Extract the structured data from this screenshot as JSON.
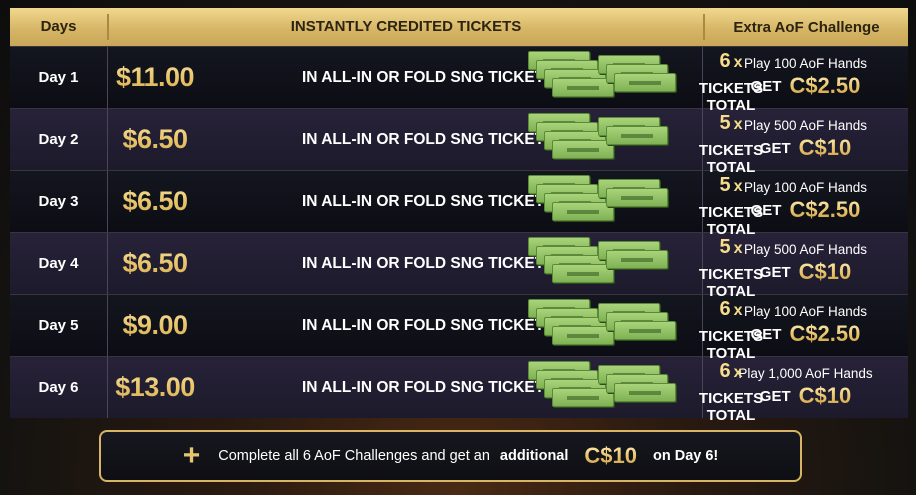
{
  "header": {
    "days": "Days",
    "tickets": "INSTANTLY CREDITED TICKETS",
    "challenge": "Extra AoF Challenge"
  },
  "rows": [
    {
      "day": "Day 1",
      "price": "$11.00",
      "label": "IN ALL-IN OR FOLD SNG TICKETS",
      "count": "6",
      "x": "x",
      "total": "TICKETS TOTAL",
      "play": "Play 100 AoF Hands",
      "get": "GET",
      "amount": "C$2.50"
    },
    {
      "day": "Day 2",
      "price": "$6.50",
      "label": "IN ALL-IN OR FOLD SNG TICKETS",
      "count": "5",
      "x": "x",
      "total": "TICKETS TOTAL",
      "play": "Play 500 AoF Hands",
      "get": "GET",
      "amount": "C$10"
    },
    {
      "day": "Day 3",
      "price": "$6.50",
      "label": "IN ALL-IN OR FOLD SNG TICKETS",
      "count": "5",
      "x": "x",
      "total": "TICKETS TOTAL",
      "play": "Play 100 AoF Hands",
      "get": "GET",
      "amount": "C$2.50"
    },
    {
      "day": "Day 4",
      "price": "$6.50",
      "label": "IN ALL-IN OR FOLD SNG TICKETS",
      "count": "5",
      "x": "x",
      "total": "TICKETS TOTAL",
      "play": "Play 500 AoF Hands",
      "get": "GET",
      "amount": "C$10"
    },
    {
      "day": "Day 5",
      "price": "$9.00",
      "label": "IN ALL-IN OR FOLD SNG TICKETS",
      "count": "6",
      "x": "x",
      "total": "TICKETS TOTAL",
      "play": "Play 100 AoF Hands",
      "get": "GET",
      "amount": "C$2.50"
    },
    {
      "day": "Day 6",
      "price": "$13.00",
      "label": "IN ALL-IN OR FOLD SNG TICKETS",
      "count": "6",
      "x": "x",
      "total": "TICKETS TOTAL",
      "play": "Play 1,000 AoF Hands",
      "get": "GET",
      "amount": "C$10"
    }
  ],
  "banner": {
    "plus": "+",
    "text1": "Complete all 6 AoF Challenges and get an",
    "bold": "additional",
    "amount": "C$10",
    "text2": "on Day 6!"
  },
  "colors": {
    "gold": "#d7b564",
    "ticket_green": "#8fc163",
    "row_dark": "#101119",
    "row_purple": "#231f33"
  }
}
